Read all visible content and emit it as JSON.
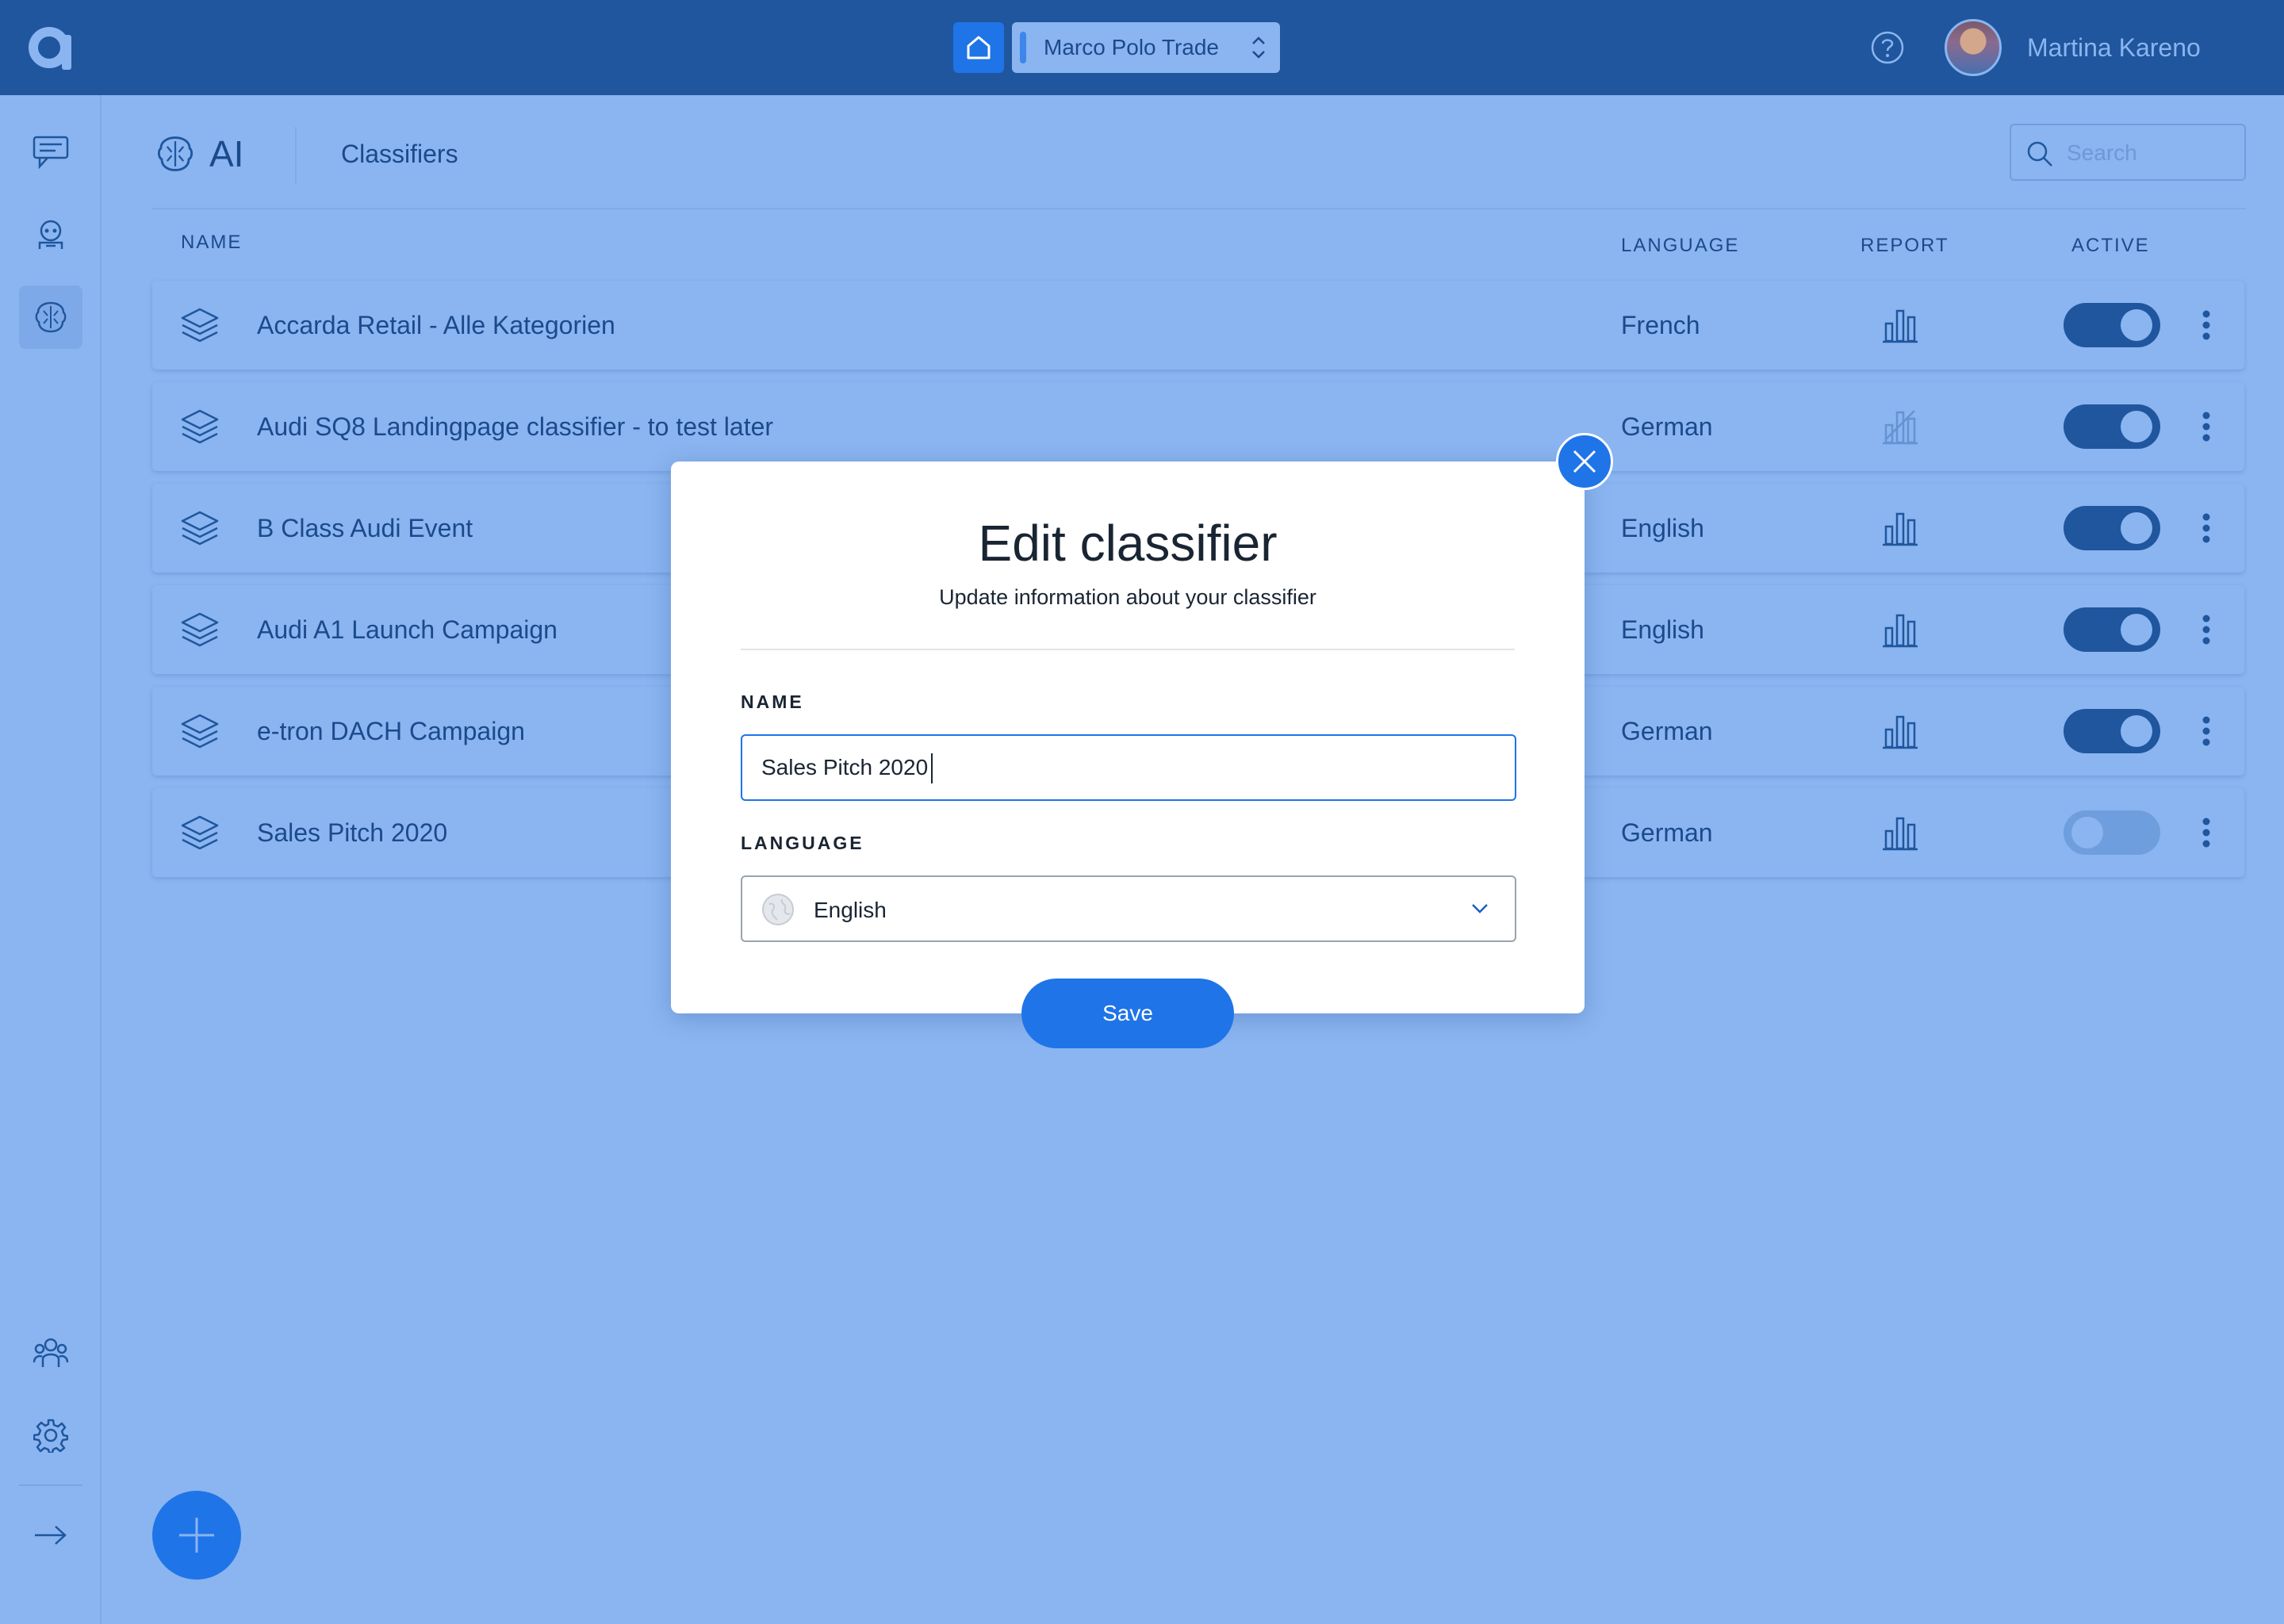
{
  "topbar": {
    "workspace": "Marco Polo Trade",
    "user_name": "Martina Kareno"
  },
  "sidebar": {
    "items": [
      "conversations-icon",
      "bot-icon",
      "ai-brain-icon",
      "team-icon",
      "settings-icon",
      "collapse-arrow-icon"
    ],
    "active": "ai-brain-icon"
  },
  "header": {
    "section": "AI",
    "breadcrumb": "Classifiers",
    "search_placeholder": "Search"
  },
  "table": {
    "columns": {
      "name": "NAME",
      "language": "LANGUAGE",
      "report": "REPORT",
      "active": "ACTIVE"
    },
    "rows": [
      {
        "name": "Accarda Retail - Alle Kategorien",
        "language": "French",
        "report_available": true,
        "active": true
      },
      {
        "name": "Audi SQ8 Landingpage classifier - to test later",
        "language": "German",
        "report_available": false,
        "active": true
      },
      {
        "name": "B Class Audi Event",
        "language": "English",
        "report_available": true,
        "active": true
      },
      {
        "name": "Audi A1 Launch Campaign",
        "language": "English",
        "report_available": true,
        "active": true
      },
      {
        "name": "e-tron DACH Campaign",
        "language": "German",
        "report_available": true,
        "active": true
      },
      {
        "name": "Sales Pitch 2020",
        "language": "German",
        "report_available": true,
        "active": false
      }
    ]
  },
  "modal": {
    "title": "Edit classifier",
    "subtitle": "Update information about your classifier",
    "name_label": "NAME",
    "name_value": "Sales Pitch 2020",
    "language_label": "LANGUAGE",
    "language_value": "English",
    "save_label": "Save"
  },
  "colors": {
    "topbar": "#1f569e",
    "background": "#8ab5f0",
    "accent": "#1f74e8",
    "text": "#1b4a8c"
  }
}
